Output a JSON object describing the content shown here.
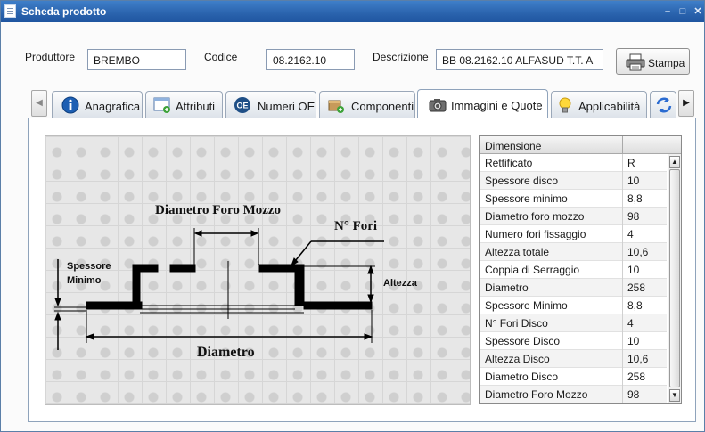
{
  "window": {
    "title": "Scheda prodotto",
    "controls": {
      "minimize": "–",
      "maximize": "□",
      "close": "✕"
    }
  },
  "header": {
    "produttore_label": "Produttore",
    "produttore_value": "BREMBO",
    "codice_label": "Codice",
    "codice_value": "08.2162.10",
    "descrizione_label": "Descrizione",
    "descrizione_value": "BB 08.2162.10 ALFASUD T.T. A",
    "print_label": "Stampa"
  },
  "tabs": [
    {
      "label": "Anagrafica",
      "icon": "info-icon"
    },
    {
      "label": "Attributi",
      "icon": "attributes-icon"
    },
    {
      "label": "Numeri OE",
      "icon": "oe-icon"
    },
    {
      "label": "Componenti",
      "icon": "components-icon"
    },
    {
      "label": "Immagini e Quote",
      "icon": "camera-icon",
      "active": true
    },
    {
      "label": "Applicabilità",
      "icon": "lightbulb-icon"
    }
  ],
  "drawing": {
    "diametro_foro_mozzo": "Diametro Foro Mozzo",
    "n_fori": "N° Fori",
    "spessore_minimo_line1": "Spessore",
    "spessore_minimo_line2": "Minimo",
    "altezza": "Altezza",
    "diametro": "Diametro"
  },
  "grid": {
    "header": "Dimensione",
    "rows": [
      {
        "k": "Rettificato",
        "v": "R"
      },
      {
        "k": "Spessore disco",
        "v": "10"
      },
      {
        "k": "Spessore minimo",
        "v": "8,8"
      },
      {
        "k": "Diametro foro mozzo",
        "v": "98"
      },
      {
        "k": "Numero fori fissaggio",
        "v": "4"
      },
      {
        "k": "Altezza totale",
        "v": "10,6"
      },
      {
        "k": "Coppia di Serraggio",
        "v": "10"
      },
      {
        "k": "Diametro",
        "v": "258"
      },
      {
        "k": "Spessore Minimo",
        "v": "8,8"
      },
      {
        "k": "N° Fori Disco",
        "v": "4"
      },
      {
        "k": "Spessore Disco",
        "v": "10"
      },
      {
        "k": "Altezza Disco",
        "v": "10,6"
      },
      {
        "k": "Diametro Disco",
        "v": "258"
      },
      {
        "k": "Diametro Foro Mozzo",
        "v": "98"
      }
    ]
  }
}
